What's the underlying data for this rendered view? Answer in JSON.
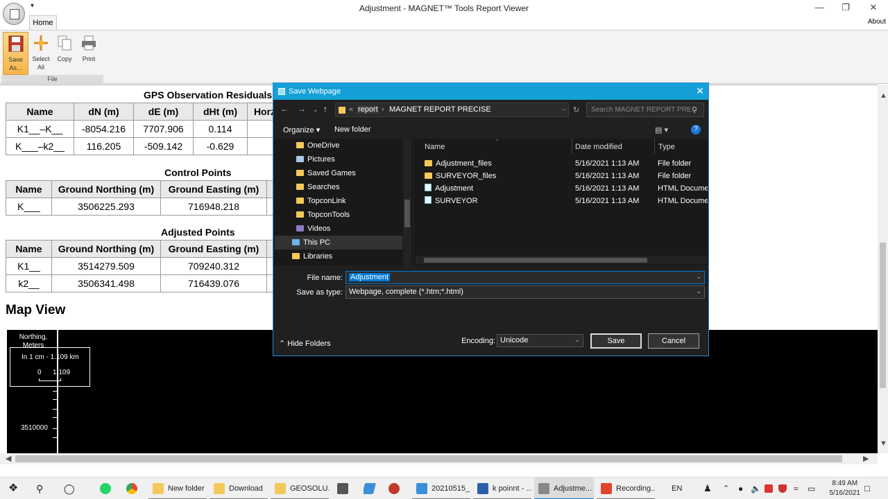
{
  "window": {
    "title": "Adjustment - MAGNET™ Tools Report Viewer",
    "minimize": "—",
    "maximize": "❐",
    "close": "✕"
  },
  "ribbon": {
    "tab_home": "Home",
    "about": "About",
    "save_label": "Save As...",
    "select_all_label": "Select All",
    "copy_label": "Copy",
    "print_label": "Print",
    "group_file": "File"
  },
  "report": {
    "gps_title": "GPS Observation Residuals",
    "gps_headers": [
      "Name",
      "dN (m)",
      "dE (m)",
      "dHt (m)",
      "Horz"
    ],
    "gps_rows": [
      [
        "K1__–K__",
        "-8054.216",
        "7707.906",
        "0.114",
        ""
      ],
      [
        "K___–k2__",
        "116.205",
        "-509.142",
        "-0.629",
        ""
      ]
    ],
    "control_title": "Control Points",
    "control_headers": [
      "Name",
      "Ground Northing (m)",
      "Ground Easting (m)",
      ""
    ],
    "control_rows": [
      [
        "K___",
        "3506225.293",
        "716948.218",
        ""
      ]
    ],
    "adjusted_title": "Adjusted Points",
    "adjusted_headers": [
      "Name",
      "Ground Northing (m)",
      "Ground Easting (m)",
      ""
    ],
    "adjusted_rows": [
      [
        "K1__",
        "3514279.509",
        "709240.312",
        ""
      ],
      [
        "k2__",
        "3506341.498",
        "716439.076",
        ""
      ]
    ],
    "map_title": "Map View",
    "map_north_label": "Northing, Meters",
    "map_scale_text": "In 1 cm - 1.109 km",
    "map_scale_zero": "0",
    "map_scale_value": "1.109",
    "map_ytick": "3510000"
  },
  "dialog": {
    "title": "Save Webpage",
    "address_prefix": "«",
    "address_parts": [
      "report",
      "MAGNET REPORT PRECISE"
    ],
    "search_placeholder": "Search MAGNET REPORT PRE...",
    "organize": "Organize ▾",
    "new_folder": "New folder",
    "nav_items": [
      {
        "label": "OneDrive"
      },
      {
        "label": "Pictures"
      },
      {
        "label": "Saved Games"
      },
      {
        "label": "Searches"
      },
      {
        "label": "TopconLink"
      },
      {
        "label": "TopconTools"
      },
      {
        "label": "Videos"
      },
      {
        "label": "This PC"
      },
      {
        "label": "Libraries"
      }
    ],
    "columns": [
      "Name",
      "Date modified",
      "Type"
    ],
    "files": [
      {
        "name": "Adjustment_files",
        "date": "5/16/2021 1:13 AM",
        "type": "File folder",
        "kind": "folder"
      },
      {
        "name": "SURVEYOR_files",
        "date": "5/16/2021 1:13 AM",
        "type": "File folder",
        "kind": "folder"
      },
      {
        "name": "Adjustment",
        "date": "5/16/2021 1:13 AM",
        "type": "HTML Document",
        "kind": "html"
      },
      {
        "name": "SURVEYOR",
        "date": "5/16/2021 1:13 AM",
        "type": "HTML Document",
        "kind": "html"
      }
    ],
    "file_name_label": "File name:",
    "file_name_value": "Adjustment",
    "save_type_label": "Save as type:",
    "save_type_value": "Webpage, complete (*.htm;*.html)",
    "hide_folders": "Hide Folders",
    "encoding_label": "Encoding:",
    "encoding_value": "Unicode",
    "save_button": "Save",
    "cancel_button": "Cancel"
  },
  "taskbar": {
    "items": [
      {
        "label": "New folder"
      },
      {
        "label": "Download"
      },
      {
        "label": "GEOSOLU..."
      },
      {
        "label": "20210515_..."
      },
      {
        "label": "k poinnt - ..."
      },
      {
        "label": "Adjustme..."
      },
      {
        "label": "Recording..."
      }
    ],
    "language": "EN",
    "time": "8:49 AM",
    "date": "5/16/2021"
  },
  "colors": {
    "dialog_title": "#15a0d8",
    "dialog_bg": "#202020",
    "selection": "#0078d7",
    "folder": "#f4c95b"
  }
}
